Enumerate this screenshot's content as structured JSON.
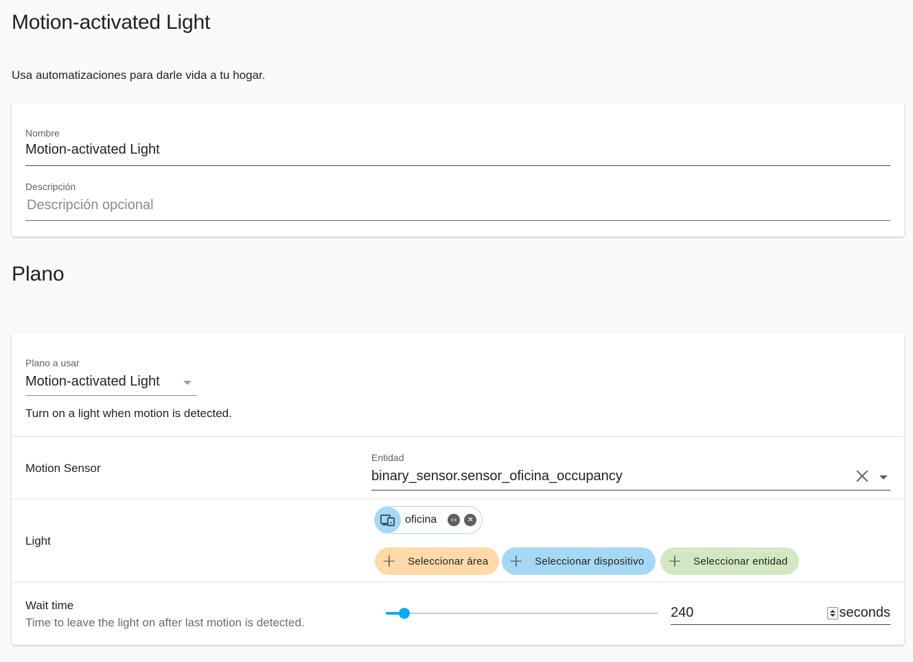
{
  "header": {
    "title": "Motion-activated Light",
    "intro": "Usa automatizaciones para darle vida a tu hogar."
  },
  "details": {
    "name_label": "Nombre",
    "name_value": "Motion-activated Light",
    "description_label": "Descripción",
    "description_placeholder": "Descripción opcional"
  },
  "blueprint": {
    "section_title": "Plano",
    "select_label": "Plano a usar",
    "select_value": "Motion-activated Light",
    "description": "Turn on a light when motion is detected.",
    "inputs": {
      "motion_sensor": {
        "label": "Motion Sensor",
        "field_label": "Entidad",
        "value": "binary_sensor.sensor_oficina_occupancy"
      },
      "light": {
        "label": "Light",
        "chip_label": "oficina",
        "chip_icon": "area-icon",
        "buttons": {
          "area": "Seleccionar área",
          "device": "Seleccionar dispositivo",
          "entity": "Seleccionar entidad"
        }
      },
      "wait_time": {
        "label": "Wait time",
        "description": "Time to leave the light on after last motion is detected.",
        "value": "240",
        "unit": "seconds",
        "slider_fraction": 0.068
      }
    }
  },
  "colors": {
    "accent": "#03a9f4",
    "area_chip": "#ffd9a8",
    "device_chip": "#a6d8f5",
    "entity_chip": "#d2e8c2"
  }
}
